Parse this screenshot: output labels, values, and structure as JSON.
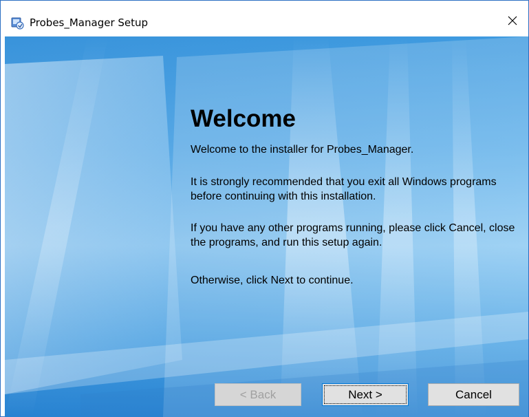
{
  "window": {
    "title": "Probes_Manager Setup",
    "close_glyph": "✕"
  },
  "welcome": {
    "heading": "Welcome",
    "intro": "Welcome to the installer for Probes_Manager.",
    "recommend": "It is strongly recommended that you exit all Windows programs before continuing with this installation.",
    "running": "If you have any other programs running, please click Cancel, close the programs, and run this setup again.",
    "otherwise": "Otherwise, click Next to continue."
  },
  "buttons": {
    "back_prefix": "< ",
    "back_label": "Back",
    "next_label": "Next",
    "next_suffix": " >",
    "cancel_label": "Cancel"
  },
  "colors": {
    "accent": "#0078d7",
    "border": "#2b6fc2",
    "background_blue": "#4aa3e4"
  },
  "icons": {
    "app": "installer-icon",
    "close": "close-icon"
  }
}
